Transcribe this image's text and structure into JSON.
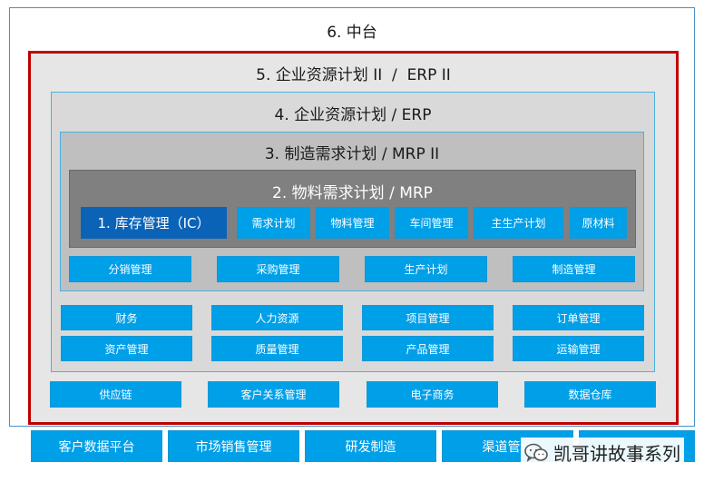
{
  "layers": {
    "l6": {
      "title": "6. 中台"
    },
    "l5": {
      "title": "5. 企业资源计划 II  /  ERP II"
    },
    "l4": {
      "title": "4. 企业资源计划 / ERP"
    },
    "l3": {
      "title": "3. 制造需求计划 / MRP II"
    },
    "l2": {
      "title": "2. 物料需求计划 / MRP"
    },
    "l1": {
      "title": "1. 库存管理（IC）"
    }
  },
  "mrp_modules": [
    "需求计划",
    "物料管理",
    "车间管理",
    "主生产计划",
    "原材料"
  ],
  "mrp2_modules": [
    "分销管理",
    "采购管理",
    "生产计划",
    "制造管理"
  ],
  "erp_modules_row1": [
    "财务",
    "人力资源",
    "项目管理",
    "订单管理"
  ],
  "erp_modules_row2": [
    "资产管理",
    "质量管理",
    "产品管理",
    "运输管理"
  ],
  "erp2_modules": [
    "供应链",
    "客户关系管理",
    "电子商务",
    "数据仓库"
  ],
  "platform_modules": [
    "客户数据平台",
    "市场销售管理",
    "研发制造",
    "渠道管理",
    ""
  ],
  "watermark": {
    "text": "凯哥讲故事系列",
    "icon": "wechat-icon"
  },
  "colors": {
    "module_blue": "#00a0e9",
    "inventory_blue": "#0b63b8",
    "erp2_highlight_border": "#c00000",
    "mrp_bg": "#808080",
    "mrp2_bg": "#bfbfbf",
    "erp_bg": "#d9d9d9",
    "erp2_bg": "#e6e6e6"
  }
}
